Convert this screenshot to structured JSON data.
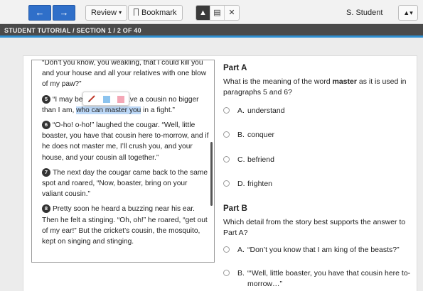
{
  "toolbar": {
    "prev_label": "←",
    "next_label": "→",
    "review_label": "Review",
    "bookmark_label": "Bookmark",
    "tools": [
      {
        "icon": "pointer-icon",
        "glyph": "▲"
      },
      {
        "icon": "note-icon",
        "glyph": "▤"
      },
      {
        "icon": "cross-out-icon",
        "glyph": "✕"
      }
    ],
    "user_name": "S. Student",
    "user_menu_glyph": "▲▾"
  },
  "breadcrumb": "STUDENT TUTORIAL / SECTION 1 / 2 OF 40",
  "passage": {
    "para_top": "“Don’t you know, you weakling, that I could kill you and your house and all your relatives with one blow of my paw?”",
    "p5_num": "5",
    "p5_before": "“I may be weak, but I have a cousin no bigger than I am, ",
    "p5_highlight": "who can master you",
    "p5_after": " in a fight.”",
    "p6_num": "6",
    "p6_text": "“O-ho! o-ho!” laughed the cougar. “Well, little boaster, you have that cousin here to-morrow, and if he does not master me, I’ll crush you, and your house, and your cousin all together.”",
    "p7_num": "7",
    "p7_text": "The next day the cougar came back to the same spot and roared, “Now, boaster, bring on your valiant cousin.”",
    "p8_num": "8",
    "p8_text": "Pretty soon he heard a buzzing near his ear. Then he felt a stinging. “Oh, oh!” he roared, “get out of my ear!” But the cricket’s cousin, the mosquito, kept on singing and stinging."
  },
  "highlighter": {
    "colors": {
      "blue": "#8cc3ee",
      "pink": "#f4a7b6",
      "selection": "#bcd8f7"
    }
  },
  "part_a": {
    "title": "Part A",
    "stem_before": "What is the meaning of the word ",
    "stem_bold": "master",
    "stem_after": " as it is used in paragraphs 5 and 6?",
    "options": [
      {
        "letter": "A.",
        "text": "understand"
      },
      {
        "letter": "B.",
        "text": "conquer"
      },
      {
        "letter": "C.",
        "text": "befriend"
      },
      {
        "letter": "D.",
        "text": "frighten"
      }
    ]
  },
  "part_b": {
    "title": "Part B",
    "stem": "Which detail from the story best supports the answer to Part A?",
    "options": [
      {
        "letter": "A.",
        "text": "“Don’t you know that I am king of the beasts?”"
      },
      {
        "letter": "B.",
        "text": "“‘Well, little boaster, you have that cousin here to-morrow…”"
      }
    ]
  },
  "colors": {
    "accent": "#2f6fc9",
    "breadcrumb_bg": "#4a4a4a",
    "breadcrumb_border": "#2f8fd1"
  }
}
